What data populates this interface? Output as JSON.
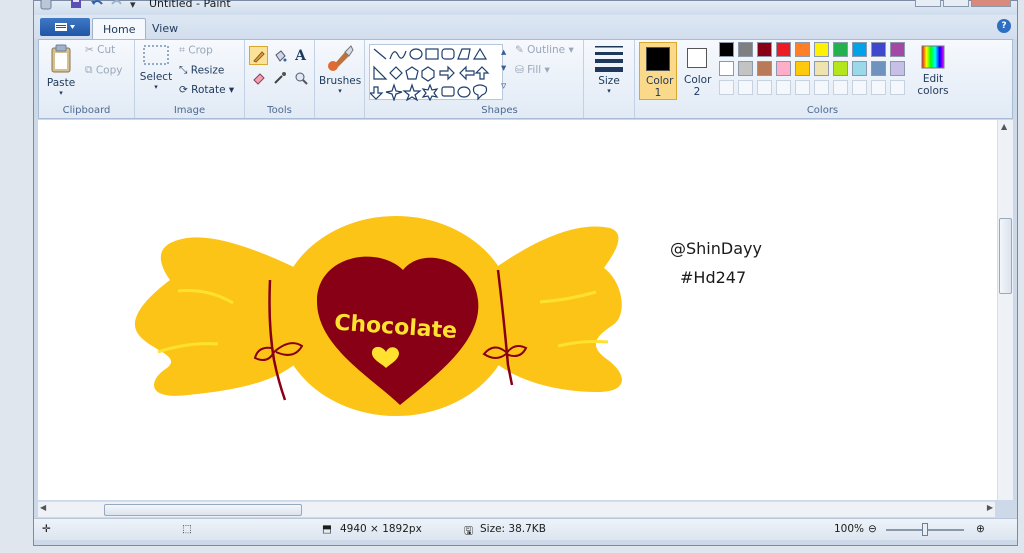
{
  "window": {
    "title": "Untitled - Paint",
    "tabs": [
      {
        "label": "Home",
        "active": true
      },
      {
        "label": "View",
        "active": false
      }
    ],
    "help_icon": "?"
  },
  "ribbon": {
    "clipboard": {
      "label": "Clipboard",
      "paste": "Paste",
      "cut": "Cut",
      "copy": "Copy"
    },
    "image": {
      "label": "Image",
      "select": "Select",
      "crop": "Crop",
      "resize": "Resize",
      "rotate": "Rotate"
    },
    "tools": {
      "label": "Tools",
      "text_tool": "A"
    },
    "brushes": {
      "label": "Brushes"
    },
    "shapes": {
      "label": "Shapes",
      "outline": "Outline",
      "fill": "Fill"
    },
    "size": {
      "label": "Size"
    },
    "colors": {
      "label": "Colors",
      "color1": "Color 1",
      "color2": "Color 2",
      "edit_colors": "Edit colors",
      "color1_value": "#000000",
      "color2_value": "#ffffff",
      "palette_row1": [
        "#000000",
        "#7f7f7f",
        "#880015",
        "#ed1c24",
        "#ff7f27",
        "#fff200",
        "#22b14c",
        "#00a2e8",
        "#3f48cc",
        "#a349a4"
      ],
      "palette_row2": [
        "#ffffff",
        "#c3c3c3",
        "#b97a57",
        "#ffaec9",
        "#ffc90e",
        "#efe4b0",
        "#b5e61d",
        "#99d9ea",
        "#7092be",
        "#c8bfe7"
      ]
    }
  },
  "canvas": {
    "drawing_text": "Chocolate",
    "credit_line1": "@ShinDayy",
    "credit_line2": "#Hd247",
    "candy_color": "#fcc417",
    "heart_color": "#880015",
    "text_color": "#ffe12f"
  },
  "status": {
    "dimensions": "4940 × 1892px",
    "size": "Size: 38.7KB",
    "zoom": "100%"
  }
}
